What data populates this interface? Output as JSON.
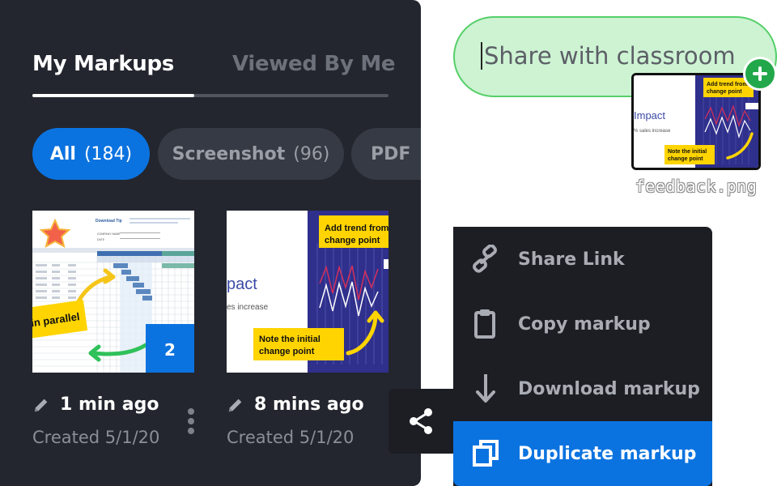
{
  "tabs": {
    "active_label": "My Markups",
    "inactive_label": "Viewed By Me"
  },
  "filters": [
    {
      "label": "All",
      "count": "(184)"
    },
    {
      "label": "Screenshot",
      "count": "(96)"
    },
    {
      "label": "PDF"
    }
  ],
  "markups": [
    {
      "time": "1 min ago",
      "created": "Created 5/1/20",
      "badge": "2",
      "preview": {
        "note": "in parallel",
        "header": "Download Tip",
        "field1": "COMPANY NAME",
        "field2": "DATE"
      }
    },
    {
      "time": "8 mins ago",
      "created": "Created 5/1/20",
      "preview": {
        "title": "pact",
        "subtitle": "es increase",
        "note_top_line1": "Add trend from",
        "note_top_line2": "change point",
        "note_bottom_line1": "Note the initial",
        "note_bottom_line2": "change point"
      }
    }
  ],
  "share_menu": {
    "items": [
      {
        "label": "Share Link",
        "icon": "link-icon"
      },
      {
        "label": "Copy markup",
        "icon": "clipboard-icon"
      },
      {
        "label": "Download markup",
        "icon": "download-icon"
      },
      {
        "label": "Duplicate markup",
        "icon": "duplicate-icon"
      }
    ]
  },
  "share_target": {
    "text": "Share with classroom",
    "file_name": "feedback.png",
    "preview": {
      "title": "Impact",
      "subtitle": "% sales increase",
      "note_top_line1": "Add trend from",
      "note_top_line2": "change point",
      "note_bottom_line1": "Note the initial",
      "note_bottom_line2": "change point"
    }
  },
  "colors": {
    "panel": "#23262e",
    "accent": "#0b73e0",
    "menu": "#1c1e24",
    "pill": "#cdf3d3",
    "pill_border": "#55cf69",
    "plus": "#22a84a"
  }
}
